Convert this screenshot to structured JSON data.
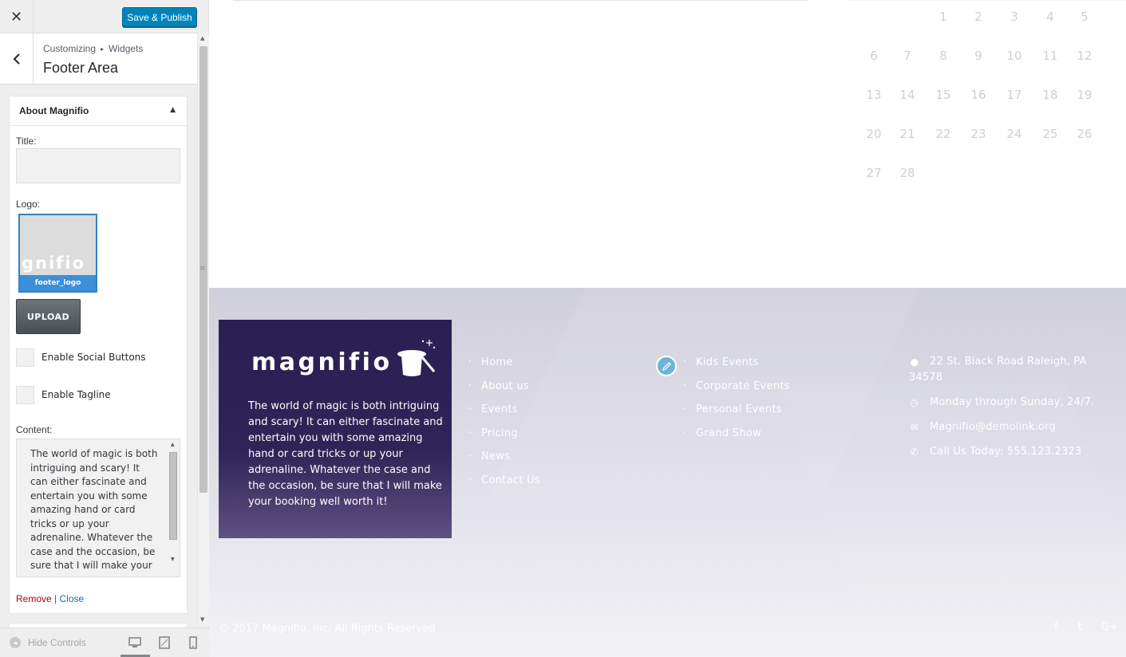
{
  "customizer": {
    "close_icon": "close-icon",
    "publish_label": "Save & Publish",
    "breadcrumb": [
      "Customizing",
      "Widgets"
    ],
    "breadcrumb_sep": "▸",
    "section_title": "Footer Area",
    "widget": {
      "title": "About Magnifio",
      "title_field_label": "Title:",
      "title_field_value": "",
      "logo_label": "Logo:",
      "logo_text": "gnifio",
      "logo_filename": "footer_logo",
      "upload_label": "UPLOAD",
      "social_label": "Enable Social Buttons",
      "tagline_label": "Enable Tagline",
      "content_label": "Content:",
      "content_value": "The world of magic is both intriguing and scary! It can either fascinate and entertain you with some amazing hand or card tricks or up your adrenaline. Whatever the case and the occasion, be sure that I will make your booking well worth it!",
      "remove_label": "Remove",
      "action_sep": "|",
      "close_label": "Close"
    },
    "hide_controls_label": "Hide Controls",
    "devices": [
      "desktop",
      "tablet",
      "mobile"
    ],
    "active_device": "desktop"
  },
  "calendar": {
    "days": [
      "1",
      "2",
      "3",
      "4",
      "5",
      "6",
      "7",
      "8",
      "9",
      "10",
      "11",
      "12",
      "13",
      "14",
      "15",
      "16",
      "17",
      "18",
      "19",
      "20",
      "21",
      "22",
      "23",
      "24",
      "25",
      "26",
      "27",
      "28"
    ]
  },
  "footer": {
    "about_logo": "magnifio",
    "about_text": "The world of magic is both intriguing and scary! It can either fascinate and entertain you with some amazing hand or card tricks or up your adrenaline. Whatever the case and the occasion, be sure that I will make your booking well worth it!",
    "nav_links": [
      "Home",
      "About us",
      "Events",
      "Pricing",
      "News",
      "Contact Us"
    ],
    "event_links": [
      "Kids Events",
      "Corporate Events",
      "Personal Events",
      "Grand Show"
    ],
    "contact": {
      "address": "22 St. Black Road Raleigh, PA 34578",
      "hours": "Monday through Sunday, 24/7.",
      "email": "Magnifio@demolink.org",
      "phone": "Call Us Today: 555.123.2323"
    },
    "copyright": "© 2017 Magnifio, Inc. All Rights Reserved",
    "social": [
      "f",
      "t",
      "G+"
    ]
  },
  "colors": {
    "publish_button": "#0085ba",
    "about_box": "#2a1f52",
    "footer_bg": "#d0cfdc",
    "remove_link": "#aa0000",
    "close_link": "#0073aa"
  }
}
